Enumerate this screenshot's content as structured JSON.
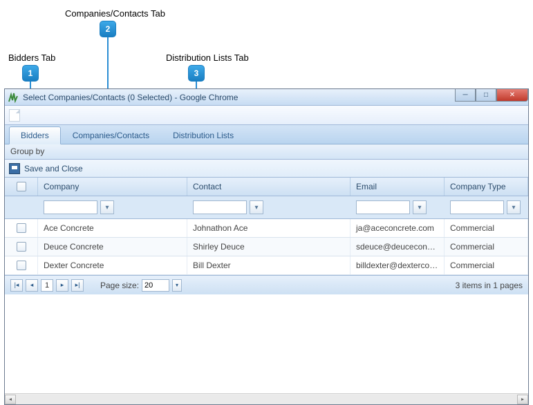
{
  "annotations": {
    "label1": "Bidders Tab",
    "marker1": "1",
    "label2": "Companies/Contacts Tab",
    "marker2": "2",
    "label3": "Distribution Lists Tab",
    "marker3": "3"
  },
  "window": {
    "title": "Select Companies/Contacts (0 Selected) - Google Chrome"
  },
  "tabs": {
    "bidders": "Bidders",
    "companies": "Companies/Contacts",
    "distribution": "Distribution Lists"
  },
  "groupbar": {
    "label": "Group by"
  },
  "savebar": {
    "label": "Save and Close"
  },
  "columns": {
    "company": "Company",
    "contact": "Contact",
    "email": "Email",
    "type": "Company Type"
  },
  "rows": [
    {
      "company": "Ace Concrete",
      "contact": "Johnathon Ace",
      "email": "ja@aceconcrete.com",
      "type": "Commercial"
    },
    {
      "company": "Deuce Concrete",
      "contact": "Shirley Deuce",
      "email": "sdeuce@deuceconcrete.",
      "type": "Commercial"
    },
    {
      "company": "Dexter Concrete",
      "contact": "Bill Dexter",
      "email": "billdexter@dexterconcret",
      "type": "Commercial"
    }
  ],
  "pager": {
    "page": "1",
    "sizeLabel": "Page size:",
    "size": "20",
    "info": "3 items in 1 pages"
  }
}
